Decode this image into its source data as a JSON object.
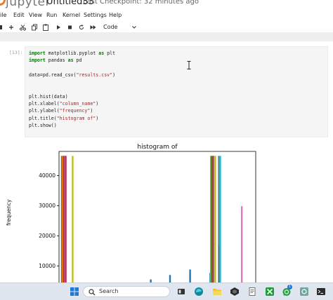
{
  "header": {
    "logo_text": "jupyter",
    "notebook_name": "Untitled33",
    "checkpoint": "Last Checkpoint: 32 minutes ago"
  },
  "menu": {
    "items": [
      "ile",
      "Edit",
      "View",
      "Run",
      "Kernel",
      "Settings",
      "Help"
    ]
  },
  "toolbar": {
    "cell_type": "Code"
  },
  "cell": {
    "prompt": "[13]:",
    "lines": [
      [
        {
          "t": "import",
          "c": "kw"
        },
        {
          "t": " matplotlib.pyplot "
        },
        {
          "t": "as",
          "c": "kw"
        },
        {
          "t": " plt"
        }
      ],
      [
        {
          "t": "import",
          "c": "kw"
        },
        {
          "t": " pandas "
        },
        {
          "t": "as",
          "c": "kw"
        },
        {
          "t": " pd"
        }
      ],
      [
        {
          "t": ""
        }
      ],
      [
        {
          "t": "data=pd.read_csv("
        },
        {
          "t": "\"results.csv\"",
          "c": "str"
        },
        {
          "t": ")"
        }
      ],
      [
        {
          "t": ""
        }
      ],
      [
        {
          "t": ""
        }
      ],
      [
        {
          "t": "plt.hist(data)"
        }
      ],
      [
        {
          "t": "plt.xlabel("
        },
        {
          "t": "\"column_name\"",
          "c": "str"
        },
        {
          "t": ")"
        }
      ],
      [
        {
          "t": "plt.ylabel("
        },
        {
          "t": "\"frequency\"",
          "c": "str"
        },
        {
          "t": ")"
        }
      ],
      [
        {
          "t": "plt.title("
        },
        {
          "t": "\"histogram of\"",
          "c": "str"
        },
        {
          "t": ")"
        }
      ],
      [
        {
          "t": "plt.show()"
        }
      ]
    ]
  },
  "chart_data": {
    "type": "bar",
    "title": "histogram of",
    "xlabel": "",
    "ylabel": "frequency",
    "ylim": [
      4500,
      48000
    ],
    "yticks": [
      10000,
      20000,
      30000,
      40000
    ],
    "ytick_labels": [
      "10000",
      "20000",
      "30000",
      "40000"
    ],
    "grid": false,
    "bars": [
      {
        "x": 0.01,
        "value": 46500,
        "color": "#1f77b4"
      },
      {
        "x": 0.014,
        "value": 46500,
        "color": "#ff7f0e"
      },
      {
        "x": 0.018,
        "value": 46500,
        "color": "#2ca02c"
      },
      {
        "x": 0.022,
        "value": 46500,
        "color": "#d62728"
      },
      {
        "x": 0.026,
        "value": 46500,
        "color": "#9467bd"
      },
      {
        "x": 0.03,
        "value": 46500,
        "color": "#c03060"
      },
      {
        "x": 0.065,
        "value": 46500,
        "color": "#bcbd22"
      },
      {
        "x": 0.462,
        "value": 5500,
        "color": "#1f77b4"
      },
      {
        "x": 0.56,
        "value": 7000,
        "color": "#1f77b4"
      },
      {
        "x": 0.662,
        "value": 8800,
        "color": "#1f77b4"
      },
      {
        "x": 0.765,
        "value": 7700,
        "color": "#1f77b4"
      },
      {
        "x": 0.768,
        "value": 46500,
        "color": "#ff7f0e"
      },
      {
        "x": 0.772,
        "value": 46500,
        "color": "#2ca02c"
      },
      {
        "x": 0.776,
        "value": 46500,
        "color": "#d62728"
      },
      {
        "x": 0.78,
        "value": 46500,
        "color": "#8c564b"
      },
      {
        "x": 0.79,
        "value": 46500,
        "color": "#bcbd22"
      },
      {
        "x": 0.808,
        "value": 46500,
        "color": "#7f7f7f"
      },
      {
        "x": 0.812,
        "value": 16700,
        "color": "#c03060"
      },
      {
        "x": 0.815,
        "value": 46500,
        "color": "#17becf"
      },
      {
        "x": 0.925,
        "value": 29800,
        "color": "#e377c2"
      }
    ]
  },
  "taskbar": {
    "search_label": "Search",
    "icons": [
      "windows-start-icon",
      "widgets-icon",
      "edge-browser-icon",
      "file-explorer-icon",
      "app-icon",
      "notepad-icon",
      "store-icon",
      "xbox-icon",
      "whatsapp-icon",
      "settings-app-icon",
      "terminal-icon"
    ],
    "whatsapp_badge": "1"
  }
}
